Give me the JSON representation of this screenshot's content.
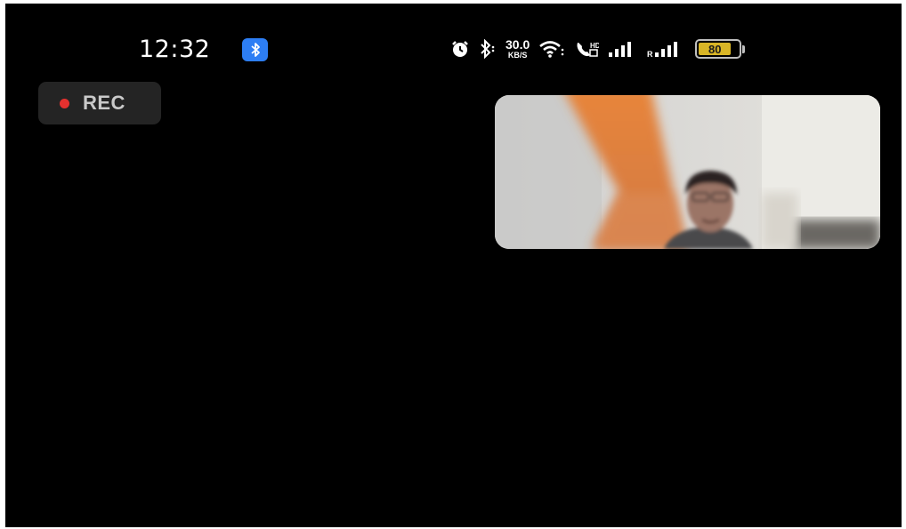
{
  "status_bar": {
    "time": "12:32",
    "notification_icon": "bluetooth-icon",
    "icons": [
      "alarm-icon",
      "bluetooth-icon",
      "wifi-icon",
      "volte-call-icon",
      "signal-icon",
      "roaming-signal-icon"
    ],
    "net_speed_value": "30.0",
    "net_speed_unit": "KB/S",
    "volte_label": "HD",
    "roaming_label": "R",
    "battery_level": "80",
    "colors": {
      "bluetooth_badge": "#2d7ef4",
      "battery_fill": "#d8b526"
    }
  },
  "recording": {
    "label": "REC",
    "dot_color": "#e5312f"
  },
  "video_preview": {
    "description_icon": "camera-preview"
  }
}
